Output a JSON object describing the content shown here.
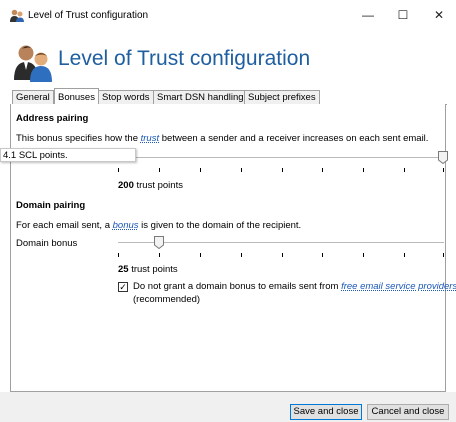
{
  "window": {
    "title": "Level of Trust configuration",
    "controls": {
      "minimize": "—",
      "maximize": "☐",
      "close": "✕"
    }
  },
  "header": {
    "title": "Level of Trust configuration",
    "icon": "users-icon"
  },
  "tabs": [
    {
      "label": "General",
      "active": false
    },
    {
      "label": "Bonuses",
      "active": true
    },
    {
      "label": "Stop words",
      "active": false
    },
    {
      "label": "Smart DSN handling",
      "active": false
    },
    {
      "label": "Subject prefixes",
      "active": false
    }
  ],
  "address_pairing": {
    "heading": "Address pairing",
    "desc_before": "This bonus specifies how the ",
    "desc_link": "trust",
    "desc_after": " between a sender and a receiver increases on each sent email.",
    "tooltip": "4.1 SCL points.",
    "slider_fraction": 1.0,
    "value_number": "200",
    "value_unit": " trust points"
  },
  "domain_pairing": {
    "heading": "Domain pairing",
    "desc_before": "For each email sent, a ",
    "desc_link": "bonus",
    "desc_after": " is given to the domain of the recipient.",
    "slider_label": "Domain bonus",
    "slider_fraction": 0.125,
    "value_number": "25",
    "value_unit": " trust points",
    "checkbox_checked": true,
    "checkbox_text": "Do not grant a domain bonus to emails sent from ",
    "checkbox_link": "free email service providers",
    "checkbox_text2": "(recommended)"
  },
  "footer": {
    "save_label": "Save and close",
    "cancel_label": "Cancel and close"
  }
}
